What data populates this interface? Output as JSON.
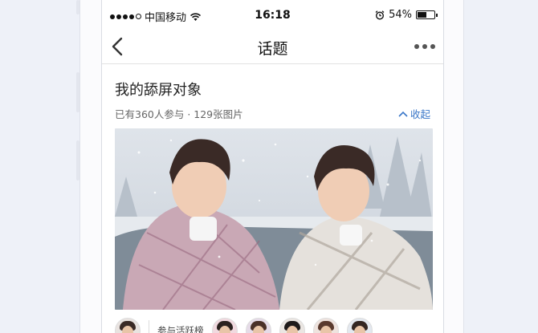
{
  "status_bar": {
    "carrier": "中国移动",
    "time": "16:18",
    "battery_percent": "54%",
    "battery_level": 0.54,
    "signal_bars_filled": 4,
    "signal_bars_total": 5
  },
  "nav": {
    "title": "话题",
    "back_icon": "chevron-left-icon",
    "more_icon": "more-dots-icon"
  },
  "topic": {
    "title": "我的舔屏对象",
    "stats": "已有360人参与 · 129张图片",
    "collapse_label": "收起",
    "collapse_icon": "chevron-up-icon"
  },
  "participants": {
    "label": "参与活跃榜",
    "avatars": [
      "avatar-1",
      "avatar-2",
      "avatar-3",
      "avatar-4",
      "avatar-5",
      "avatar-6"
    ]
  },
  "colors": {
    "accent": "#3a77c8",
    "text_primary": "#222222",
    "text_secondary": "#666666",
    "background": "#eef1f8"
  }
}
